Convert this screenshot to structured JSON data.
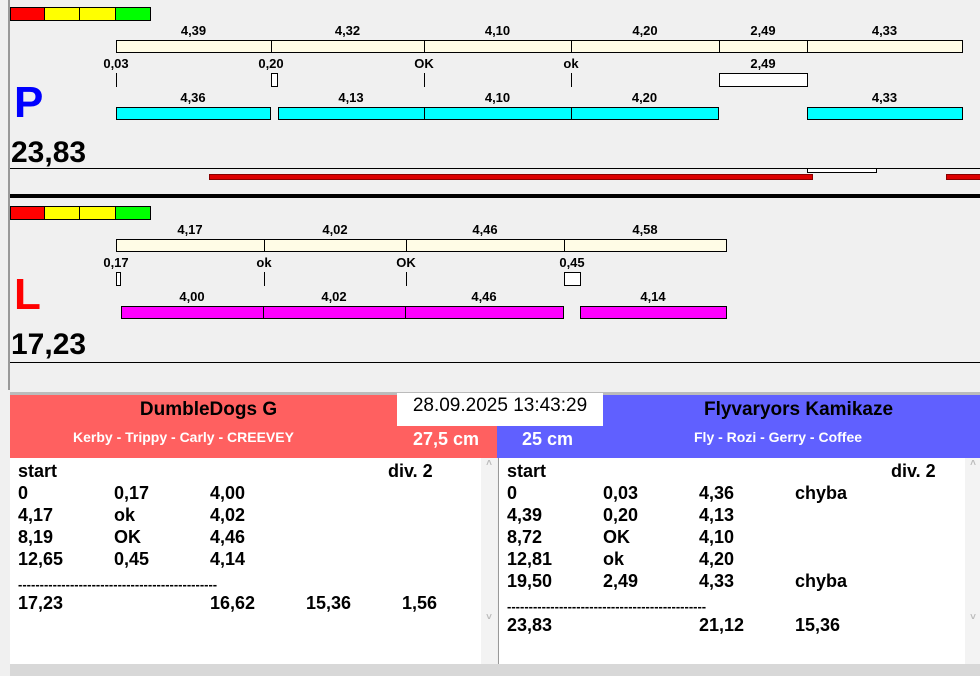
{
  "colors": {
    "red": "#ff0000",
    "yellow": "#ffff00",
    "green": "#00ff00",
    "beige": "#fffce6",
    "cyan": "#00ffff",
    "magenta": "#ff00ff",
    "team_left": "#ff6060",
    "team_right": "#6060ff"
  },
  "P": {
    "letter": "P",
    "total": "23,83",
    "top_labels": [
      "4,39",
      "4,32",
      "4,10",
      "4,20",
      "2,49",
      "4,33"
    ],
    "mid_labels": [
      "0,03",
      "0,20",
      "OK",
      "ok",
      "2,49"
    ],
    "bottom_labels": [
      "4,36",
      "4,13",
      "4,10",
      "4,20",
      "4,33"
    ]
  },
  "L": {
    "letter": "L",
    "total": "17,23",
    "top_labels": [
      "4,17",
      "4,02",
      "4,46",
      "4,58"
    ],
    "mid_labels": [
      "0,17",
      "ok",
      "OK",
      "0,45"
    ],
    "bottom_labels": [
      "4,00",
      "4,02",
      "4,46",
      "4,14"
    ]
  },
  "datetime": "28.09.2025 13:43:29",
  "left_team": {
    "name": "DumbleDogs G",
    "members": "Kerby - Trippy - Carly - CREEVEY",
    "size": "27,5 cm",
    "header": [
      "start",
      "div. 2"
    ],
    "rows": [
      [
        "0",
        "0,17",
        "4,00",
        ""
      ],
      [
        "4,17",
        "ok",
        "4,02",
        ""
      ],
      [
        "8,19",
        "OK",
        "4,46",
        ""
      ],
      [
        "12,65",
        "0,45",
        "4,14",
        ""
      ]
    ],
    "separator": "----------------------------------------------",
    "totals": [
      "17,23",
      "",
      "16,62",
      "15,36",
      "1,56"
    ]
  },
  "right_team": {
    "name": "Flyvaryors Kamikaze",
    "members": "Fly - Rozi - Gerry - Coffee",
    "size": "25 cm",
    "header": [
      "start",
      "div. 2"
    ],
    "rows": [
      [
        "0",
        "0,03",
        "4,36",
        "chyba"
      ],
      [
        "4,39",
        "0,20",
        "4,13",
        ""
      ],
      [
        "8,72",
        "OK",
        "4,10",
        ""
      ],
      [
        "12,81",
        "ok",
        "4,20",
        ""
      ],
      [
        "19,50",
        "2,49",
        "4,33",
        "chyba"
      ]
    ],
    "separator": "----------------------------------------------",
    "totals": [
      "23,83",
      "",
      "21,12",
      "15,36",
      ""
    ]
  }
}
